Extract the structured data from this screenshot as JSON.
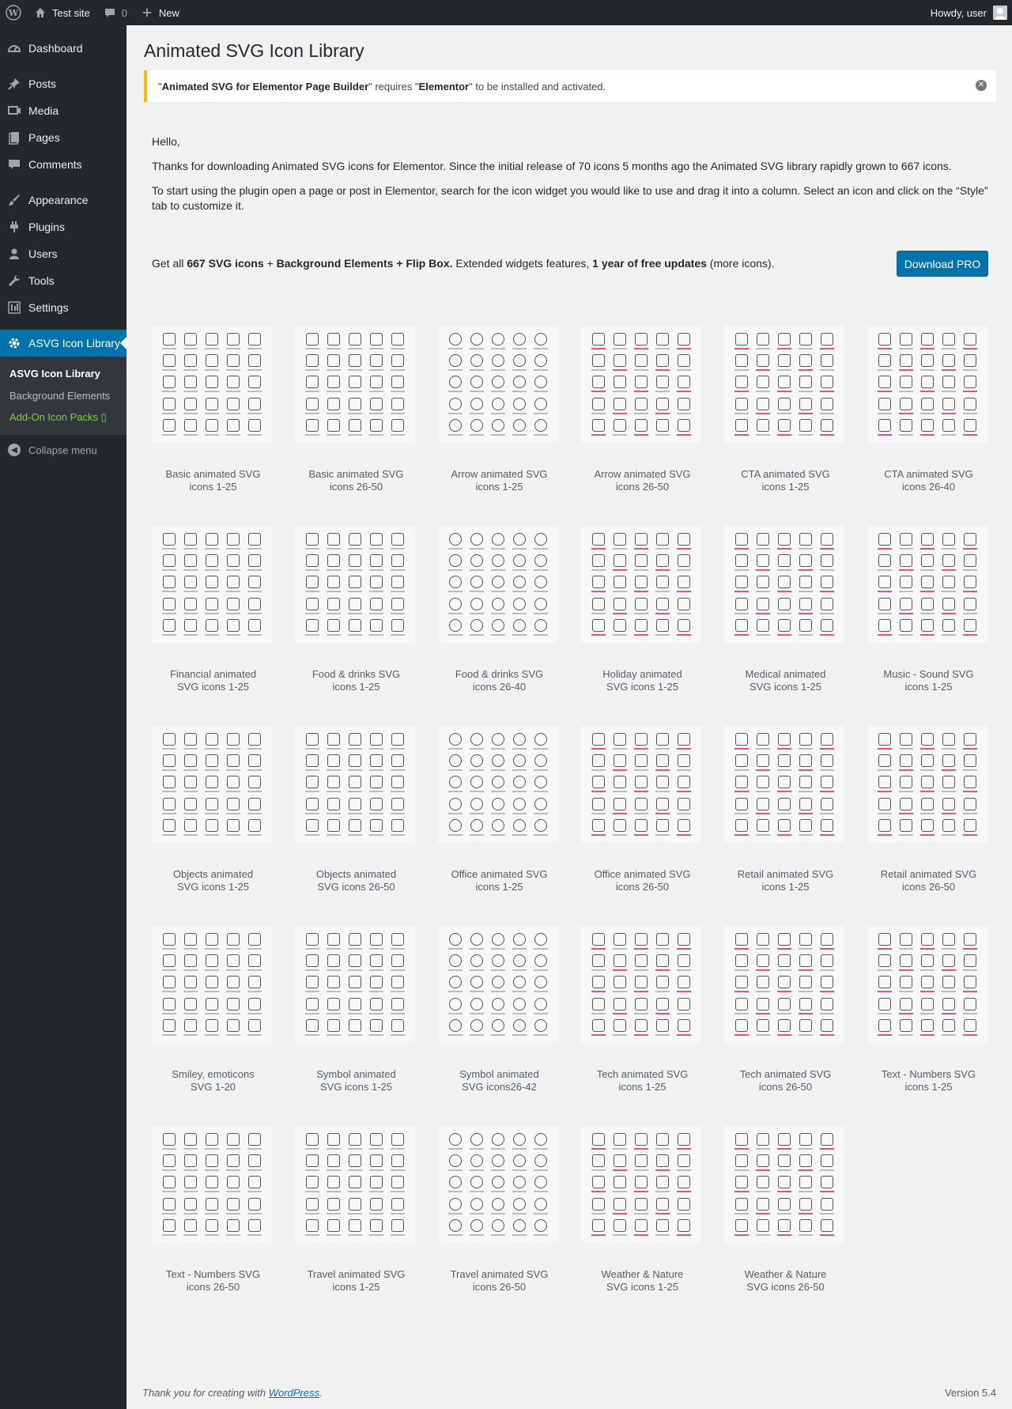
{
  "adminbar": {
    "site_name": "Test site",
    "comments_count": "0",
    "new_label": "New",
    "howdy": "Howdy, user"
  },
  "menu": {
    "dashboard": "Dashboard",
    "posts": "Posts",
    "media": "Media",
    "pages": "Pages",
    "comments": "Comments",
    "appearance": "Appearance",
    "plugins": "Plugins",
    "users": "Users",
    "tools": "Tools",
    "settings": "Settings",
    "asvg": "ASVG Icon Library",
    "sub_library": "ASVG Icon Library",
    "sub_backgrounds": "Background Elements",
    "sub_addon": "Add-On Icon Packs ▯",
    "collapse": "Collapse menu"
  },
  "page": {
    "title": "Animated SVG Icon Library",
    "notice_q1": "\"",
    "notice_plugin": "Animated SVG for Elementor Page Builder",
    "notice_mid": "\" requires \"",
    "notice_req": "Elementor",
    "notice_end": "\" to be installed and activated.",
    "hello": "Hello,",
    "para1": "Thanks for downloading Animated SVG icons for Elementor. Since the initial release of 70 icons 5 months ago the Animated SVG library rapidly grown to 667 icons.",
    "para2": "To start using the plugin open a page or post in Elementor, search for the icon widget you would like to use and drag it into a column. Select an icon and click on the “Style” tab to customize it.",
    "promo_a": "Get all ",
    "promo_b": "667 SVG icons",
    "promo_c": " + ",
    "promo_d": "Background Elements + Flip Box.",
    "promo_e": "  Extended widgets features, ",
    "promo_f": "1 year of free updates",
    "promo_g": " (more icons).",
    "download_pro": "Download PRO"
  },
  "packs": [
    {
      "label1": "Basic animated SVG",
      "label2": "icons 1-25"
    },
    {
      "label1": "Basic animated SVG",
      "label2": "icons 26-50"
    },
    {
      "label1": "Arrow animated SVG",
      "label2": "icons 1-25"
    },
    {
      "label1": "Arrow animated SVG",
      "label2": "icons 26-50"
    },
    {
      "label1": "CTA animated SVG",
      "label2": "icons 1-25"
    },
    {
      "label1": "CTA animated SVG",
      "label2": "icons 26-40"
    },
    {
      "label1": "Financial animated",
      "label2": "SVG icons 1-25"
    },
    {
      "label1": "Food & drinks SVG",
      "label2": "icons 1-25"
    },
    {
      "label1": "Food & drinks SVG",
      "label2": "icons 26-40"
    },
    {
      "label1": "Holiday animated",
      "label2": "SVG icons 1-25"
    },
    {
      "label1": "Medical animated",
      "label2": "SVG icons 1-25"
    },
    {
      "label1": "Music - Sound SVG",
      "label2": "icons 1-25"
    },
    {
      "label1": "Objects animated",
      "label2": "SVG icons 1-25"
    },
    {
      "label1": "Objects animated",
      "label2": "SVG icons 26-50"
    },
    {
      "label1": "Office animated SVG",
      "label2": "icons 1-25"
    },
    {
      "label1": "Office animated SVG",
      "label2": "icons 26-50"
    },
    {
      "label1": "Retail animated SVG",
      "label2": "icons 1-25"
    },
    {
      "label1": "Retail animated SVG",
      "label2": "icons 26-50"
    },
    {
      "label1": "Smiley, emoticons",
      "label2": "SVG 1-20"
    },
    {
      "label1": "Symbol animated",
      "label2": "SVG icons 1-25"
    },
    {
      "label1": "Symbol animated",
      "label2": "SVG icons26-42"
    },
    {
      "label1": "Tech animated SVG",
      "label2": "icons 1-25"
    },
    {
      "label1": "Tech animated SVG",
      "label2": "icons 26-50"
    },
    {
      "label1": "Text - Numbers SVG",
      "label2": "icons 1-25"
    },
    {
      "label1": "Text - Numbers SVG",
      "label2": "icons 26-50"
    },
    {
      "label1": "Travel animated SVG",
      "label2": "icons 1-25"
    },
    {
      "label1": "Travel animated SVG",
      "label2": "icons 26-50"
    },
    {
      "label1": "Weather & Nature",
      "label2": "SVG icons 1-25"
    },
    {
      "label1": "Weather & Nature",
      "label2": "SVG icons 26-50"
    }
  ],
  "footer": {
    "thanks": "Thank you for creating with ",
    "wp_link": "WordPress",
    "period": ".",
    "version": "Version 5.4"
  },
  "colors": {
    "accent": "#0073aa",
    "notice_warning": "#ffb900",
    "menu_bg": "#23282d",
    "addon_green": "#7ad03a"
  }
}
